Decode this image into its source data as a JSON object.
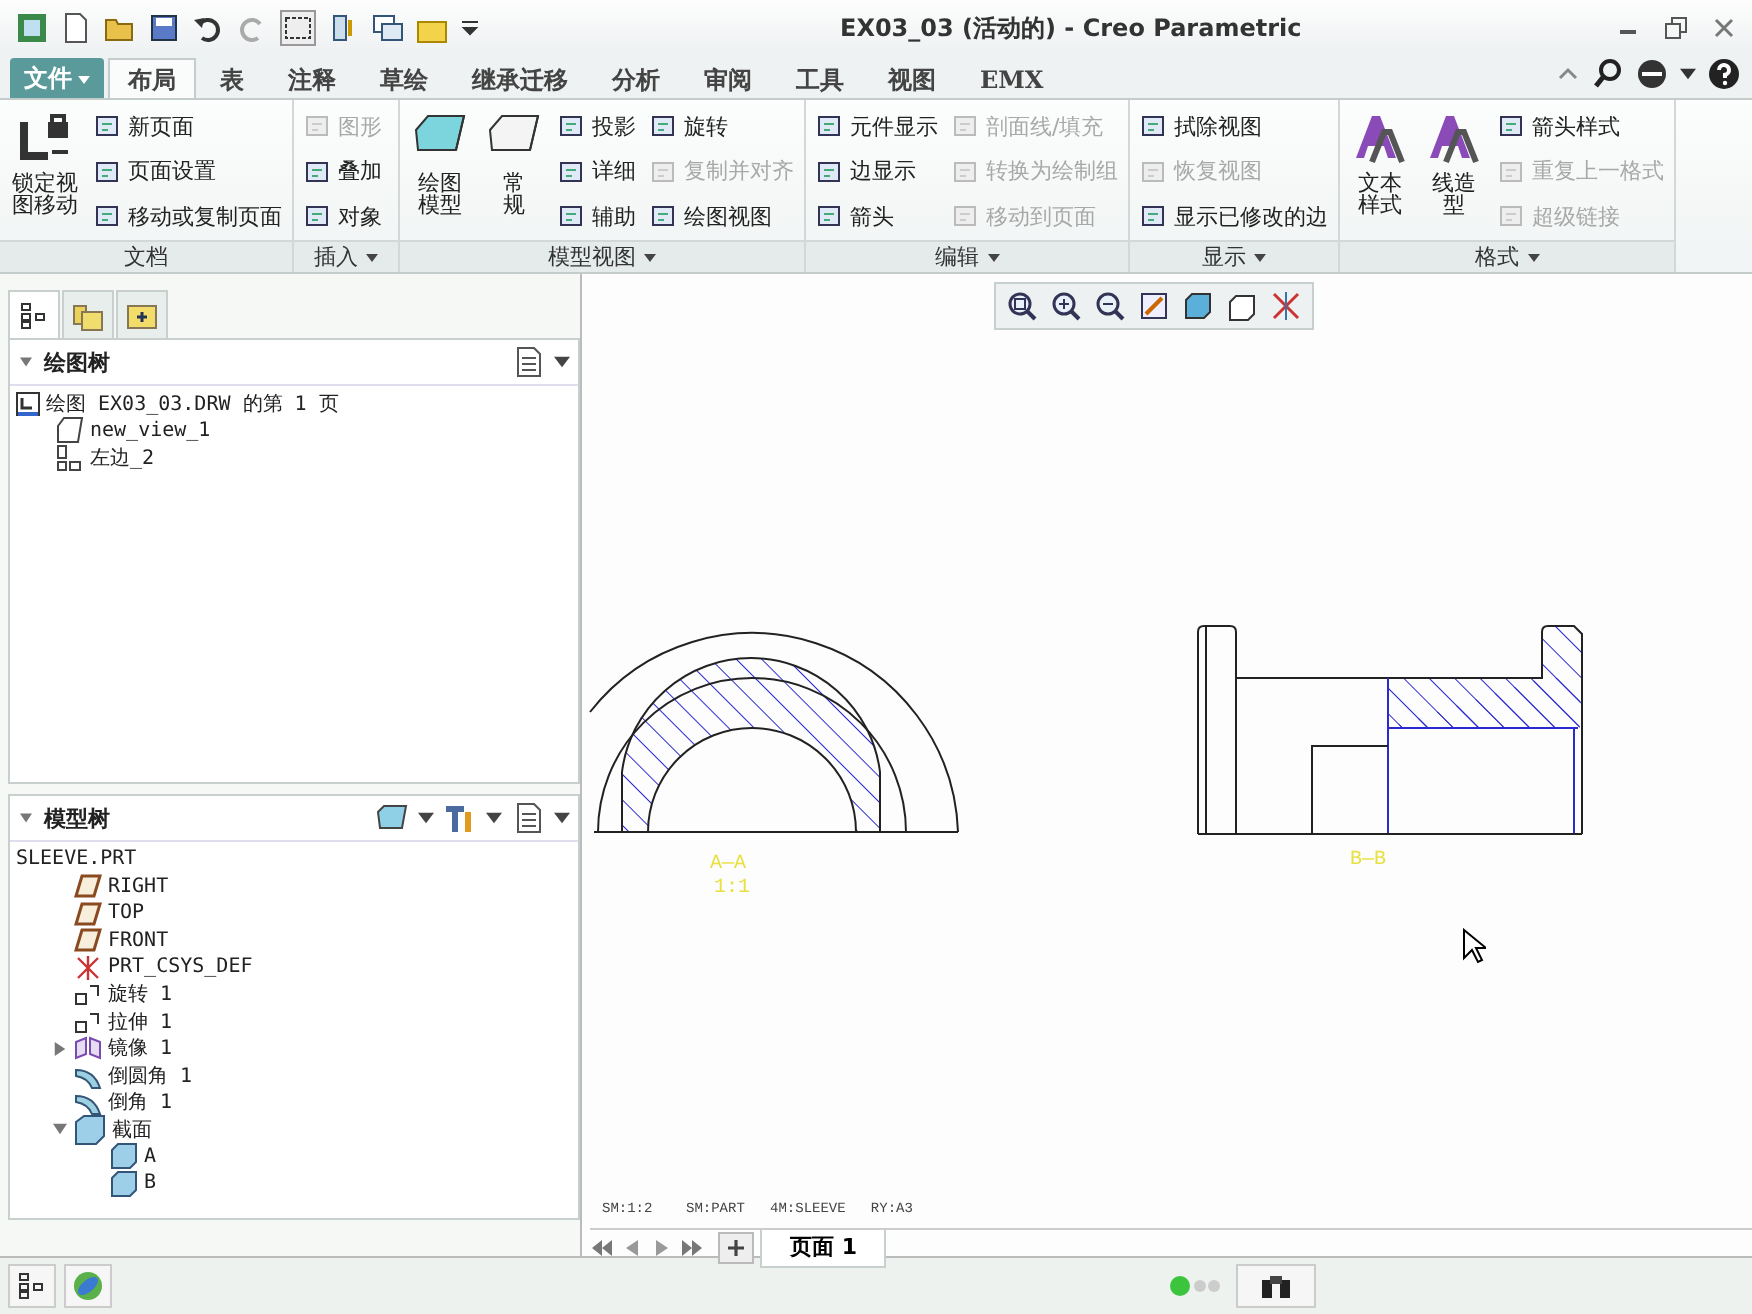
{
  "window": {
    "title": "EX03_03 (活动的) - Creo Parametric"
  },
  "ribbon_tabs": [
    {
      "label": "文件",
      "kind": "menu",
      "selected": false
    },
    {
      "label": "布局",
      "kind": "tab",
      "selected": true
    },
    {
      "label": "表",
      "kind": "tab",
      "selected": false
    },
    {
      "label": "注释",
      "kind": "tab",
      "selected": false
    },
    {
      "label": "草绘",
      "kind": "tab",
      "selected": false
    },
    {
      "label": "继承迁移",
      "kind": "tab",
      "selected": false
    },
    {
      "label": "分析",
      "kind": "tab",
      "selected": false
    },
    {
      "label": "审阅",
      "kind": "tab",
      "selected": false
    },
    {
      "label": "工具",
      "kind": "tab",
      "selected": false
    },
    {
      "label": "视图",
      "kind": "tab",
      "selected": false
    },
    {
      "label": "EMX",
      "kind": "tab",
      "selected": false
    }
  ],
  "ribbon_groups": [
    {
      "label": "文档",
      "menu": false,
      "columns": [
        [
          {
            "kind": "large",
            "label": "锁定视图移动",
            "disabled": false
          }
        ],
        [
          {
            "kind": "small",
            "label": "新页面",
            "disabled": false
          },
          {
            "kind": "small",
            "label": "页面设置",
            "disabled": false
          },
          {
            "kind": "small",
            "label": "移动或复制页面",
            "disabled": false
          }
        ]
      ]
    },
    {
      "label": "插入",
      "menu": true,
      "columns": [
        [
          {
            "kind": "small",
            "label": "图形",
            "disabled": true
          },
          {
            "kind": "small",
            "label": "叠加",
            "disabled": false
          },
          {
            "kind": "small",
            "label": "对象",
            "disabled": false
          }
        ]
      ]
    },
    {
      "label": "模型视图",
      "menu": true,
      "columns": [
        [
          {
            "kind": "large",
            "label": "绘图模型",
            "disabled": false
          }
        ],
        [
          {
            "kind": "large",
            "label": "常规",
            "disabled": false
          }
        ],
        [
          {
            "kind": "small",
            "label": "投影",
            "disabled": false
          },
          {
            "kind": "small",
            "label": "详细",
            "disabled": false
          },
          {
            "kind": "small",
            "label": "辅助",
            "disabled": false
          }
        ],
        [
          {
            "kind": "small",
            "label": "旋转",
            "disabled": false
          },
          {
            "kind": "small",
            "label": "复制并对齐",
            "disabled": true
          },
          {
            "kind": "small",
            "label": "绘图视图",
            "disabled": false
          }
        ]
      ]
    },
    {
      "label": "编辑",
      "menu": true,
      "columns": [
        [
          {
            "kind": "small",
            "label": "元件显示",
            "disabled": false
          },
          {
            "kind": "small",
            "label": "边显示",
            "disabled": false
          },
          {
            "kind": "small",
            "label": "箭头",
            "disabled": false
          }
        ],
        [
          {
            "kind": "small",
            "label": "剖面线/填充",
            "disabled": true
          },
          {
            "kind": "small",
            "label": "转换为绘制组",
            "disabled": true
          },
          {
            "kind": "small",
            "label": "移动到页面",
            "disabled": true
          }
        ]
      ]
    },
    {
      "label": "显示",
      "menu": true,
      "columns": [
        [
          {
            "kind": "small",
            "label": "拭除视图",
            "disabled": false
          },
          {
            "kind": "small",
            "label": "恢复视图",
            "disabled": true
          },
          {
            "kind": "small",
            "label": "显示已修改的边",
            "disabled": false
          }
        ]
      ]
    },
    {
      "label": "格式",
      "menu": true,
      "columns": [
        [
          {
            "kind": "large",
            "label": "文本样式",
            "disabled": false
          }
        ],
        [
          {
            "kind": "large",
            "label": "线造型",
            "disabled": false
          }
        ],
        [
          {
            "kind": "small",
            "label": "箭头样式",
            "disabled": false
          },
          {
            "kind": "small",
            "label": "重复上一格式",
            "disabled": true
          },
          {
            "kind": "small",
            "label": "超级链接",
            "disabled": true
          }
        ]
      ]
    }
  ],
  "panel_tabs": [
    {
      "selected": true
    },
    {
      "selected": false
    },
    {
      "selected": false
    }
  ],
  "drawing_tree": {
    "title": "绘图树",
    "expanded": true,
    "items": [
      {
        "label": "绘图 EX03_03.DRW 的第 1 页",
        "kind": "sheet",
        "children": [
          {
            "label": "new_view_1",
            "kind": "view"
          },
          {
            "label": "左边_2",
            "kind": "projection"
          }
        ]
      }
    ]
  },
  "model_tree": {
    "title": "模型树",
    "expanded": true,
    "root": "SLEEVE.PRT",
    "items": [
      {
        "label": "RIGHT",
        "kind": "plane"
      },
      {
        "label": "TOP",
        "kind": "plane"
      },
      {
        "label": "FRONT",
        "kind": "plane"
      },
      {
        "label": "PRT_CSYS_DEF",
        "kind": "csys"
      },
      {
        "label": "旋转 1",
        "kind": "feature"
      },
      {
        "label": "拉伸 1",
        "kind": "feature"
      },
      {
        "label": "镜像 1",
        "kind": "mirror",
        "expanded": false
      },
      {
        "label": "倒圆角 1",
        "kind": "round"
      },
      {
        "label": "倒角 1",
        "kind": "round"
      },
      {
        "label": "截面",
        "kind": "folder",
        "expanded": true,
        "children": [
          {
            "label": "A",
            "kind": "section"
          },
          {
            "label": "B",
            "kind": "section"
          }
        ]
      }
    ]
  },
  "canvas": {
    "views": [
      {
        "kind": "section_round",
        "label": "A—A",
        "scale": "1:1"
      },
      {
        "kind": "section_side",
        "label": "B—B"
      }
    ],
    "sheet_info": "SM:1:2    SM:PART   4M:SLEEVE   RY:A3",
    "pages": [
      {
        "label": "页面 1",
        "selected": true
      }
    ]
  }
}
